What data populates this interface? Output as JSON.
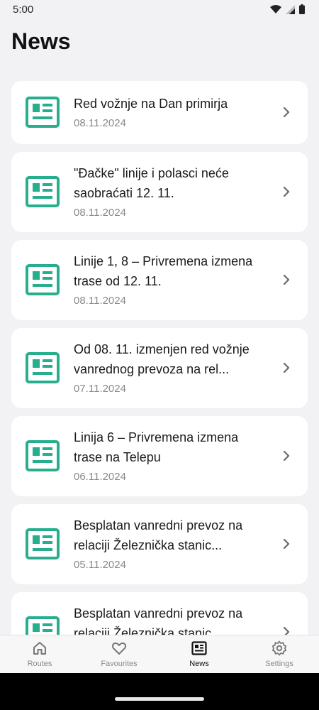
{
  "status": {
    "time": "5:00"
  },
  "page": {
    "title": "News"
  },
  "colors": {
    "accent": "#27ae8e",
    "background": "#f2f2f4",
    "card": "#ffffff"
  },
  "news": [
    {
      "title": "Red vožnje na Dan primirja",
      "date": "08.11.2024"
    },
    {
      "title": "\"Đačke\" linije i polasci neće saobraćati 12. 11.",
      "date": "08.11.2024"
    },
    {
      "title": "Linije 1, 8 – Privremena izmena trase od 12. 11.",
      "date": "08.11.2024"
    },
    {
      "title": "Od 08. 11. izmenjen red vožnje vanrednog prevoza na rel...",
      "date": "07.11.2024"
    },
    {
      "title": "Linija 6 – Privremena izmena trase na Telepu",
      "date": "06.11.2024"
    },
    {
      "title": "Besplatan vanredni prevoz na relaciji Železnička stanic...",
      "date": "05.11.2024"
    },
    {
      "title": "Besplatan vanredni prevoz na relaciji Železnička stanic...",
      "date": ""
    }
  ],
  "nav": {
    "routes": "Routes",
    "favourites": "Favourites",
    "news": "News",
    "settings": "Settings"
  }
}
